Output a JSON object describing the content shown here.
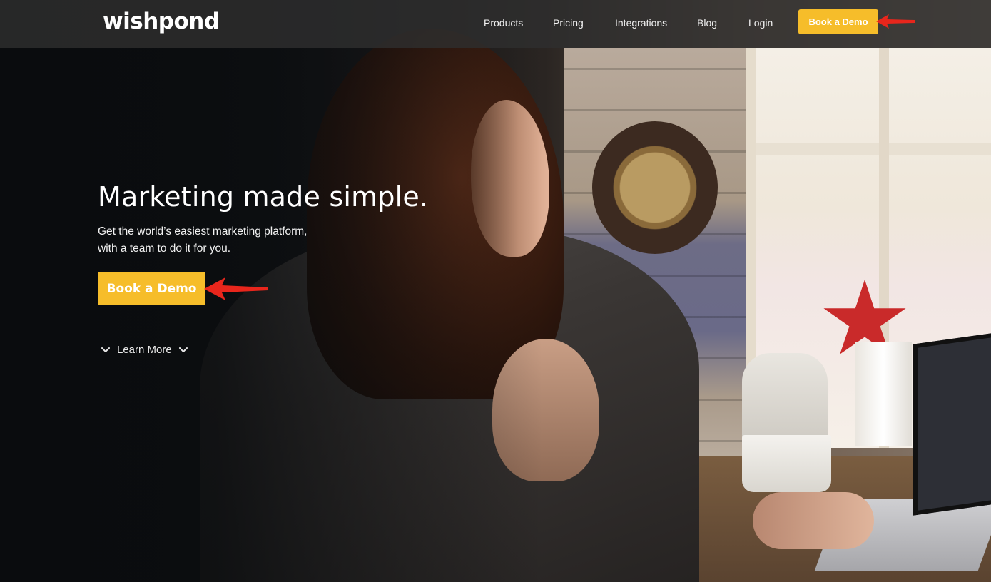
{
  "brand": {
    "logo_text": "wishpond"
  },
  "nav": {
    "links": [
      {
        "label": "Products"
      },
      {
        "label": "Pricing"
      },
      {
        "label": "Integrations"
      },
      {
        "label": "Blog"
      },
      {
        "label": "Login"
      }
    ],
    "cta_label": "Book a Demo"
  },
  "hero": {
    "headline": "Marketing made simple.",
    "subline_1": "Get the world’s easiest marketing platform,",
    "subline_2": "with a team to do it for you.",
    "cta_label": "Book a Demo",
    "learn_more_label": "Learn More"
  },
  "colors": {
    "accent": "#f6bd2a",
    "nav_bg": "#2e2e2e",
    "annotation_arrow": "#e8261c"
  },
  "icons": {
    "learn_more_left": "chevron-down-icon",
    "learn_more_right": "chevron-down-icon",
    "annotation": "red-arrow-icon"
  }
}
